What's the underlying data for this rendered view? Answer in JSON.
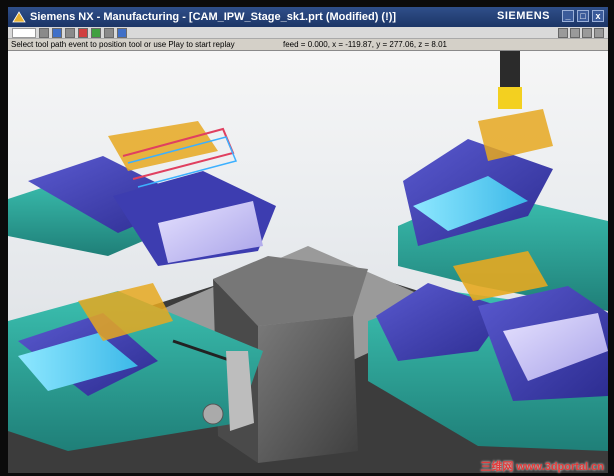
{
  "window": {
    "title": "Siemens NX - Manufacturing - [CAM_IPW_Stage_sk1.prt (Modified)     (!)]",
    "brand": "SIEMENS",
    "buttons": [
      "_",
      "□",
      "x"
    ]
  },
  "status": {
    "prompt": "Select tool path event to position tool or use Play to start replay",
    "coords": "feed = 0.000, x = -119.87, y = 277.06, z = 8.01"
  },
  "toolbar": {
    "icons": [
      "dropdown",
      "select-icon",
      "snap-icon",
      "view-icon",
      "render-icon",
      "play-icon",
      "move-icon",
      "rotate-icon"
    ]
  },
  "watermark": "三维网 www.3dportal.cn",
  "colors": {
    "title_bar": "#2f4f8a",
    "fixture_blue": "#3a3aa8",
    "fixture_teal": "#2aa89a",
    "base_gray": "#5a5a5a",
    "part_orange": "#e6a820",
    "toolpath": "#e04060"
  }
}
